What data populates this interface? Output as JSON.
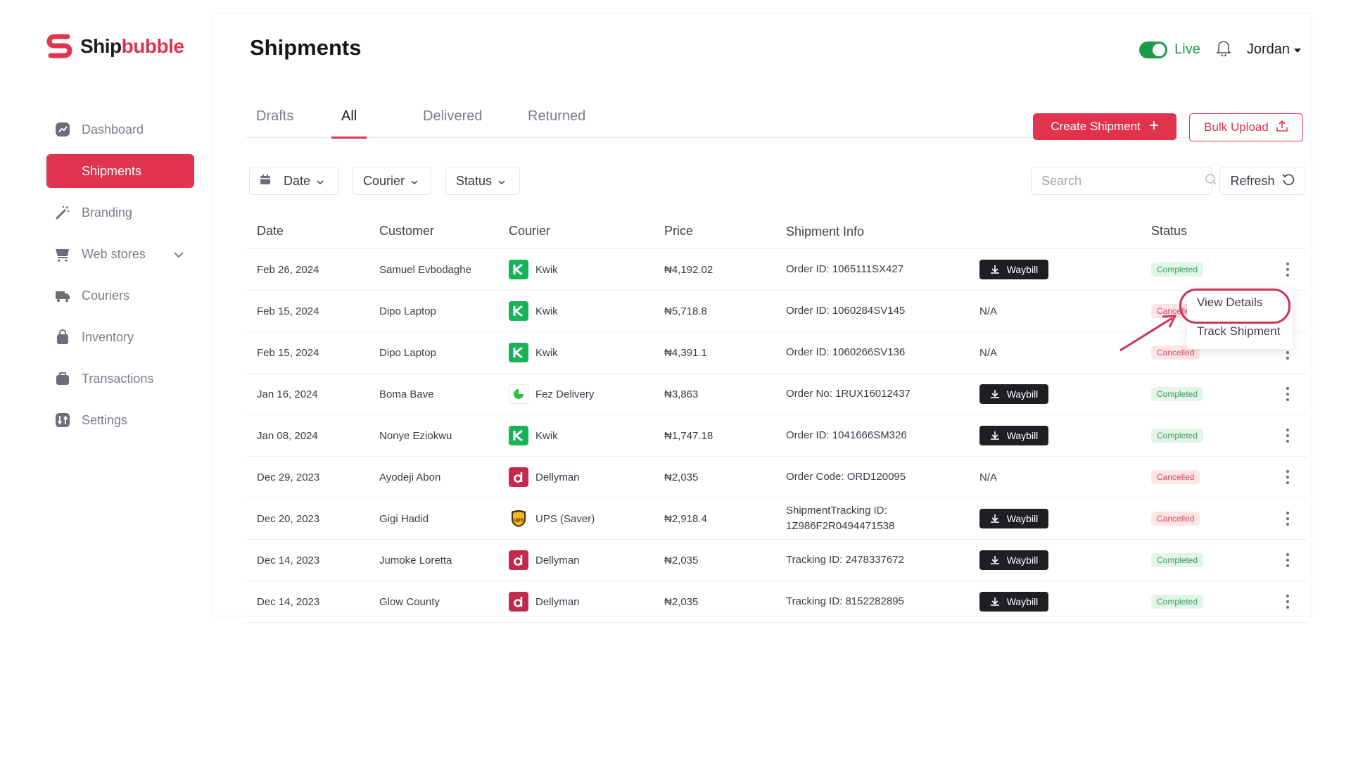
{
  "app": {
    "logo_part1": "Ship",
    "logo_part2": "bubble",
    "accent": "#e0334d"
  },
  "sidebar": {
    "items": [
      {
        "label": "Dashboard",
        "icon": "dashboard-icon"
      },
      {
        "label": "Shipments",
        "icon": "truck-icon",
        "active": true
      },
      {
        "label": "Branding",
        "icon": "magic-wand-icon"
      },
      {
        "label": "Web stores",
        "icon": "cart-icon"
      },
      {
        "label": "Couriers",
        "icon": "courier-icon"
      },
      {
        "label": "Inventory",
        "icon": "bag-icon"
      },
      {
        "label": "Transactions",
        "icon": "wallet-icon"
      },
      {
        "label": "Settings",
        "icon": "settings-icon"
      }
    ]
  },
  "header": {
    "title": "Shipments",
    "live_label": "Live",
    "user_name": "Jordan"
  },
  "tabs": [
    "Drafts",
    "All",
    "Delivered",
    "Returned"
  ],
  "actions": {
    "create": "Create Shipment",
    "bulk": "Bulk Upload"
  },
  "filters": {
    "date": "Date",
    "courier": "Courier",
    "status": "Status",
    "search_placeholder": "Search",
    "refresh": "Refresh"
  },
  "table": {
    "headers": [
      "Date",
      "Customer",
      "Courier",
      "Price",
      "Shipment Info",
      "Status"
    ],
    "waybill_label": "Waybill",
    "rows": [
      {
        "date": "Feb 26, 2024",
        "customer": "Samuel Evbodaghe",
        "courier": "Kwik",
        "price": "₦4,192.02",
        "info1": "Order ID: 1065111SX427",
        "info2": "",
        "waybill": true,
        "na": "",
        "status": "Completed"
      },
      {
        "date": "Feb 15, 2024",
        "customer": "Dipo Laptop",
        "courier": "Kwik",
        "price": "₦5,718.8",
        "info1": "Order ID: 1060284SV145",
        "info2": "",
        "waybill": false,
        "na": "N/A",
        "status": "Cancelled"
      },
      {
        "date": "Feb 15, 2024",
        "customer": "Dipo Laptop",
        "courier": "Kwik",
        "price": "₦4,391.1",
        "info1": "Order ID: 1060266SV136",
        "info2": "",
        "waybill": false,
        "na": "N/A",
        "status": "Cancelled"
      },
      {
        "date": "Jan 16, 2024",
        "customer": "Boma Bave",
        "courier": "Fez Delivery",
        "price": "₦3,863",
        "info1": "Order No: 1RUX16012437",
        "info2": "",
        "waybill": true,
        "na": "",
        "status": "Completed"
      },
      {
        "date": "Jan 08, 2024",
        "customer": "Nonye Eziokwu",
        "courier": "Kwik",
        "price": "₦1,747.18",
        "info1": "Order ID: 1041666SM326",
        "info2": "",
        "waybill": true,
        "na": "",
        "status": "Completed"
      },
      {
        "date": "Dec 29, 2023",
        "customer": "Ayodeji Abon",
        "courier": "Dellyman",
        "price": "₦2,035",
        "info1": "Order Code: ORD120095",
        "info2": "",
        "waybill": false,
        "na": "N/A",
        "status": "Cancelled"
      },
      {
        "date": "Dec 20, 2023",
        "customer": "Gigi Hadid",
        "courier": "UPS (Saver)",
        "price": "₦2,918.4",
        "info1": "ShipmentTracking ID:",
        "info2": "1Z986F2R0494471538",
        "waybill": true,
        "na": "",
        "status": "Cancelled"
      },
      {
        "date": "Dec 14, 2023",
        "customer": "Jumoke Loretta",
        "courier": "Dellyman",
        "price": "₦2,035",
        "info1": "Tracking ID: 2478337672",
        "info2": "",
        "waybill": true,
        "na": "",
        "status": "Completed"
      },
      {
        "date": "Dec 14, 2023",
        "customer": "Glow County",
        "courier": "Dellyman",
        "price": "₦2,035",
        "info1": "Tracking ID: 8152282895",
        "info2": "",
        "waybill": true,
        "na": "",
        "status": "Completed"
      }
    ]
  },
  "menu": {
    "view": "View Details",
    "track": "Track Shipment"
  }
}
